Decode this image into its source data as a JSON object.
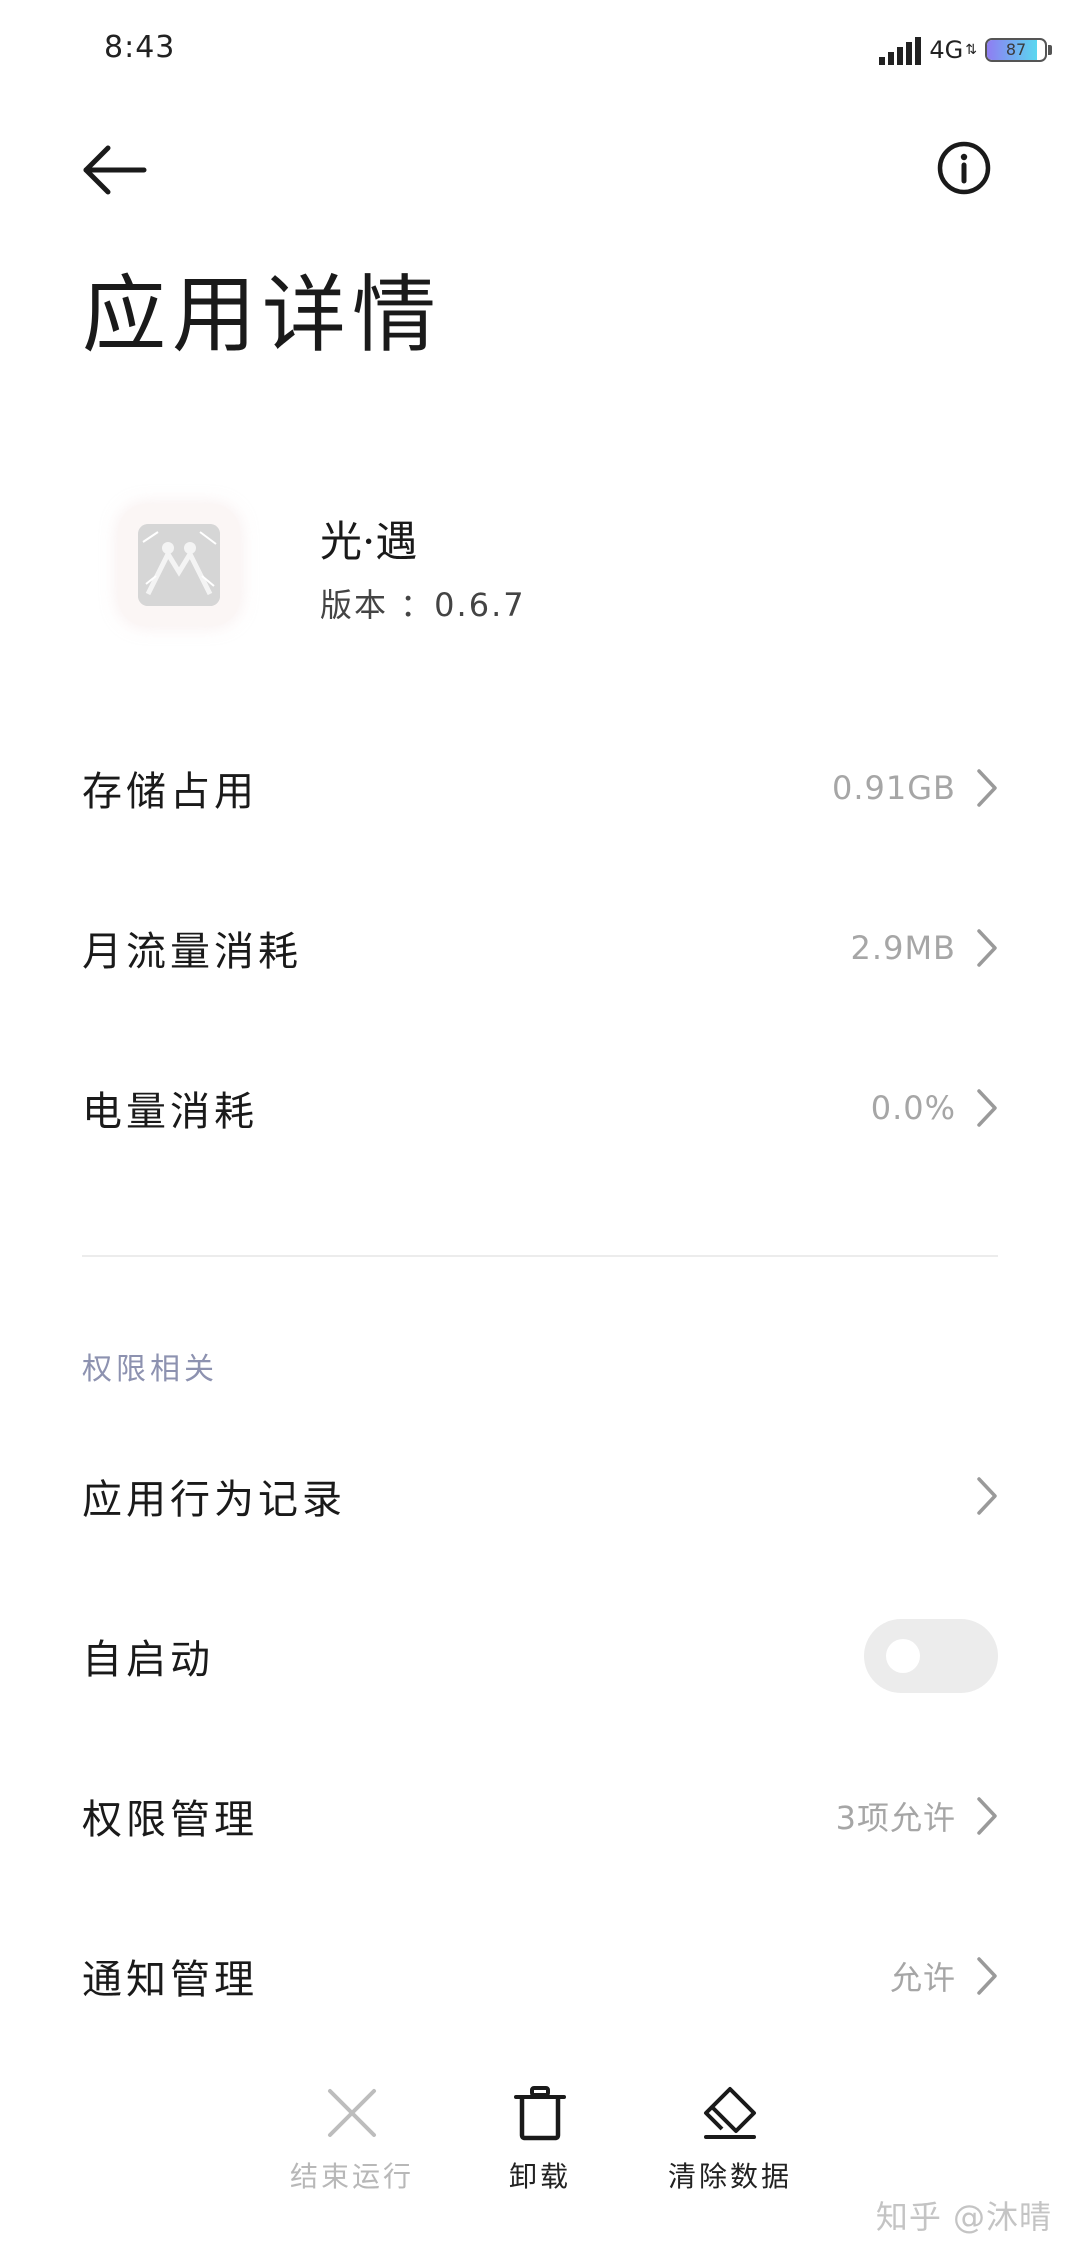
{
  "status_bar": {
    "time": "8:43",
    "network": "4G",
    "battery_level": "87",
    "battery_fraction": 0.87
  },
  "header": {
    "back_icon": "arrow-left-icon",
    "info_icon": "info-circle-icon",
    "title": "应用详情"
  },
  "app": {
    "name": "光·遇",
    "version": "版本 ：0.6.7"
  },
  "usage": [
    {
      "label": "存储占用",
      "value": "0.91GB"
    },
    {
      "label": "月流量消耗",
      "value": "2.9MB"
    },
    {
      "label": "电量消耗",
      "value": "0.0%"
    }
  ],
  "permissions": {
    "section_title": "权限相关",
    "behavior_record": {
      "label": "应用行为记录"
    },
    "autostart": {
      "label": "自启动",
      "enabled": false
    },
    "permission_manage": {
      "label": "权限管理",
      "value": "3项允许"
    },
    "notification_manage": {
      "label": "通知管理",
      "value": "允许"
    }
  },
  "actions": {
    "force_stop": {
      "label": "结束运行",
      "icon": "close-icon",
      "enabled": false
    },
    "uninstall": {
      "label": "卸载",
      "icon": "trash-icon",
      "enabled": true
    },
    "clear_data": {
      "label": "清除数据",
      "icon": "eraser-icon",
      "enabled": true
    }
  },
  "watermark": "知乎 @沐晴",
  "colors": {
    "accent_section": "#8d92b0",
    "value_gray": "#a6a6a6",
    "battery_gradient_start": "#8f7df2",
    "battery_gradient_end": "#5ad7f0"
  }
}
